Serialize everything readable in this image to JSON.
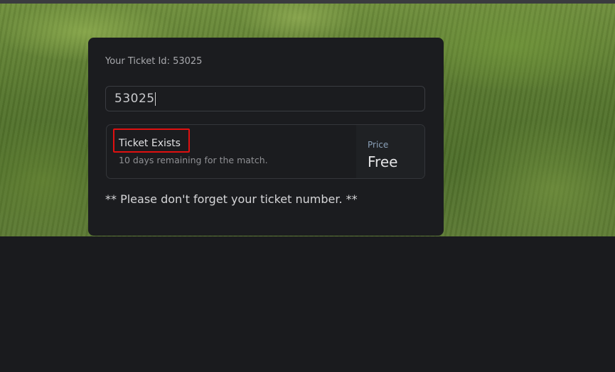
{
  "ticket": {
    "id_label": "Your Ticket Id: 53025",
    "input_value": "53025"
  },
  "status": {
    "title": "Ticket Exists",
    "subtitle": "10 days remaining for the match.",
    "highlight_color": "#e01010"
  },
  "price": {
    "label": "Price",
    "value": "Free"
  },
  "reminder": "** Please don't forget your ticket number. **"
}
